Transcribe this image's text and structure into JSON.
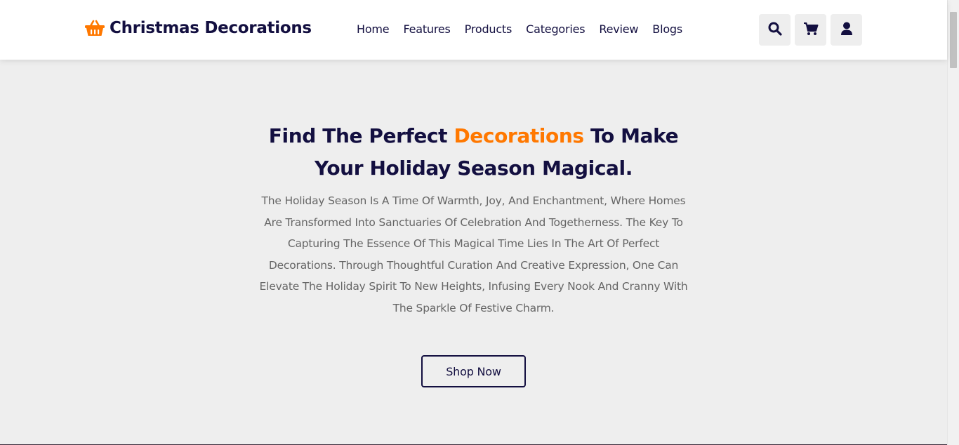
{
  "header": {
    "logo_icon": "basket-icon",
    "logo_text": "Christmas Decorations",
    "nav": [
      "Home",
      "Features",
      "Products",
      "Categories",
      "Review",
      "Blogs"
    ],
    "icons": [
      "search-icon",
      "cart-icon",
      "user-icon"
    ]
  },
  "hero": {
    "title_part1": "Find The Perfect ",
    "title_accent": "Decorations",
    "title_part2": " To Make Your Holiday Season Magical.",
    "paragraph": "The Holiday Season Is A Time Of Warmth, Joy, And Enchantment, Where Homes Are Transformed Into Sanctuaries Of Celebration And Togetherness. The Key To Capturing The Essence Of This Magical Time Lies In The Art Of Perfect Decorations. Through Thoughtful Curation And Creative Expression, One Can Elevate The Holiday Spirit To New Heights, Infusing Every Nook And Cranny With The Sparkle Of Festive Charm.",
    "button_label": "Shop Now"
  },
  "colors": {
    "primary": "#130f40",
    "accent": "#ff7800",
    "background": "#eeeeee",
    "text_muted": "#666666"
  }
}
